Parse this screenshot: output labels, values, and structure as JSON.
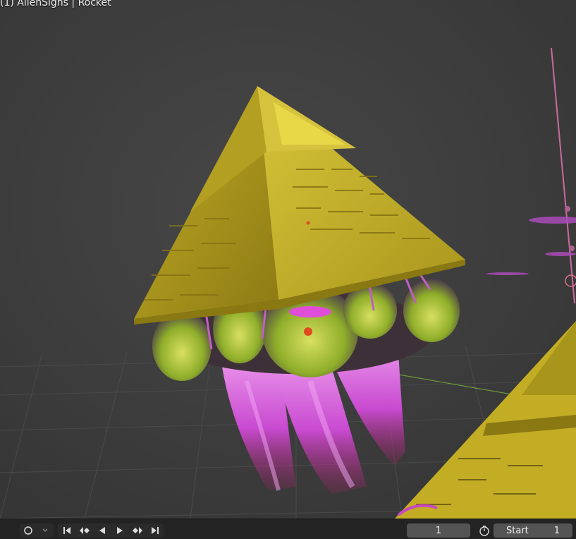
{
  "viewport": {
    "label": "(1) AlienSigns | Rocket"
  },
  "timeline": {
    "current_frame": "1",
    "start_label": "Start",
    "start_value": "1"
  },
  "icons": [
    "record-circle-icon",
    "dropdown-chevron-icon",
    "jump-to-start-icon",
    "prev-keyframe-icon",
    "play-reverse-icon",
    "play-icon",
    "next-keyframe-icon",
    "jump-to-end-icon",
    "stopwatch-icon"
  ],
  "colors": {
    "viewport_bg": "#3d3d3d",
    "pyramid_gold": "#c9b52a",
    "flame_magenta": "#d14bd8",
    "exhaust_green": "#c8d84a",
    "timeline_bg": "#232323"
  }
}
